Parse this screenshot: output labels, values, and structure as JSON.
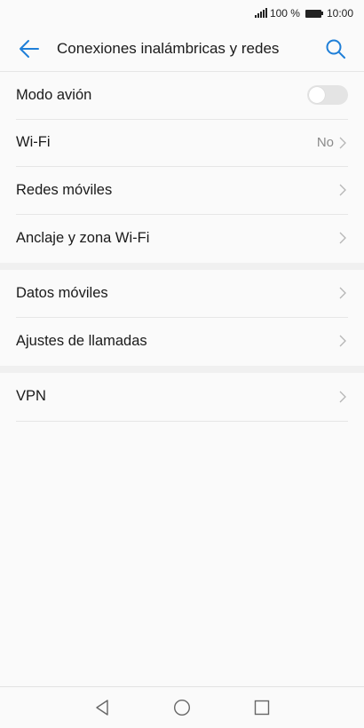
{
  "status_bar": {
    "battery_percent": "100 %",
    "time": "10:00"
  },
  "header": {
    "title": "Conexiones inalámbricas y redes",
    "back_icon": "back-arrow-icon",
    "search_icon": "search-icon"
  },
  "colors": {
    "accent": "#1f7fd8",
    "text": "#1a1a1a",
    "secondary_text": "#8a8a8a",
    "divider": "#e6e6e6",
    "section_gap": "#f0f0f0"
  },
  "groups": [
    {
      "items": [
        {
          "label": "Modo avión",
          "type": "toggle",
          "toggle_on": false
        },
        {
          "label": "Wi-Fi",
          "type": "chevron",
          "value": "No"
        },
        {
          "label": "Redes móviles",
          "type": "chevron"
        },
        {
          "label": "Anclaje y zona Wi-Fi",
          "type": "chevron"
        }
      ]
    },
    {
      "items": [
        {
          "label": "Datos móviles",
          "type": "chevron"
        },
        {
          "label": "Ajustes de llamadas",
          "type": "chevron"
        }
      ]
    },
    {
      "items": [
        {
          "label": "VPN",
          "type": "chevron"
        }
      ]
    }
  ],
  "nav_bar": {
    "back": "nav-back-icon",
    "home": "nav-home-icon",
    "recents": "nav-recents-icon"
  }
}
